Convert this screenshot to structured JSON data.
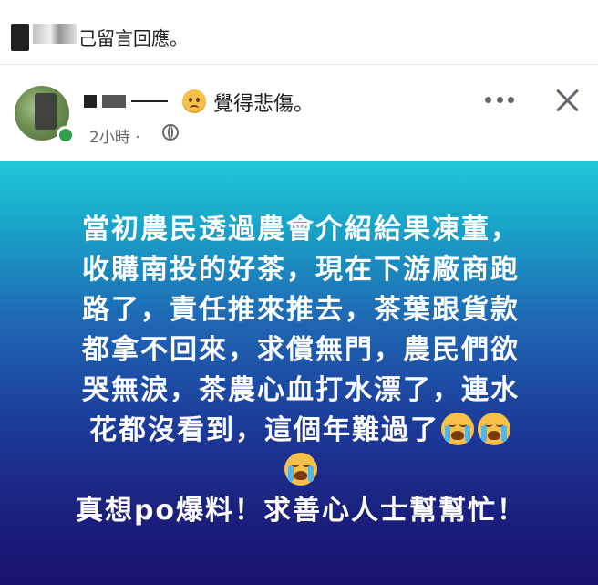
{
  "notification": {
    "text": "己留言回應。"
  },
  "post": {
    "feeling_text": "覺得悲傷。",
    "time": "2小時 ·",
    "body_lines": [
      "當初農民透過農會介紹給果凍董，",
      "收購南投的好茶，現在下游廠商跑",
      "路了，責任推來推去，茶葉跟貨款",
      "都拿不回來，求償無門，農民們欲",
      "哭無淚，茶農心血打水漂了，連水",
      "花都沒看到，這個年難過了"
    ],
    "closing_line": "真想po爆料！求善心人士幫幫忙！",
    "emojis": [
      "crying-face-icon",
      "crying-face-icon",
      "crying-face-icon"
    ]
  },
  "colors": {
    "gradient_top": "#1fc9d8",
    "gradient_bottom": "#1a1270",
    "online": "#31a24c",
    "secondary_text": "#65676b"
  }
}
